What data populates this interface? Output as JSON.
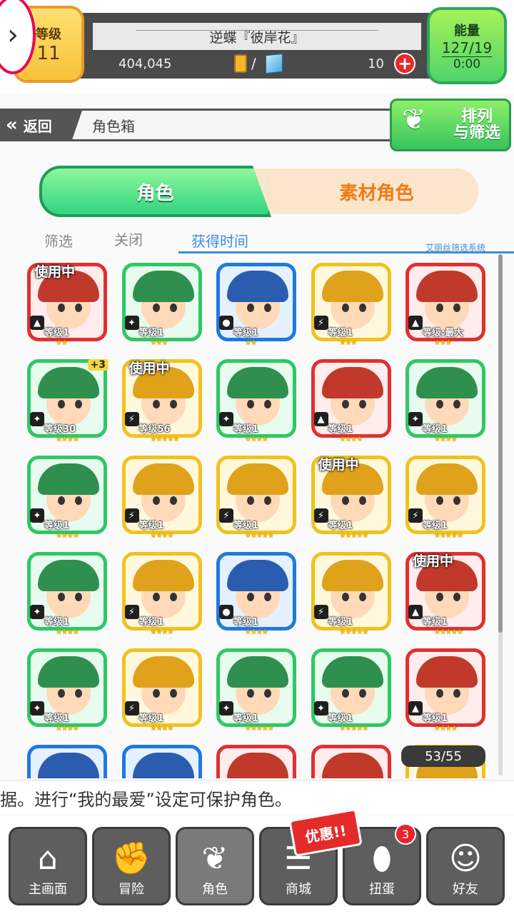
{
  "header": {
    "level_label": "等级",
    "level_value": "11",
    "player_name": "逆蝶『彼岸花』",
    "gold": "404,045",
    "stone_separator": "/",
    "stones": "10",
    "energy_label": "能量",
    "energy_value": "127/19",
    "energy_timer": "0:00",
    "plus_icon": "plus-icon",
    "colors": {
      "level_bg": "#f7c23a",
      "energy_bg": "#4fd46a"
    }
  },
  "backbar": {
    "back_label": "返回",
    "page_title": "角色箱",
    "sort_button_line1": "排列",
    "sort_button_line2": "与筛选"
  },
  "tabs": {
    "character": "角色",
    "material": "素材角色"
  },
  "filter": {
    "label": "筛选",
    "value": "关闭",
    "sort_key": "获得时间",
    "system_label": "艾丽丝筛选系统"
  },
  "cards": [
    {
      "frame": "red",
      "element": "fire",
      "level": "等级1",
      "stars": 2,
      "in_use": "使用中"
    },
    {
      "frame": "green",
      "element": "wood",
      "level": "等级1",
      "stars": 3
    },
    {
      "frame": "blue",
      "element": "water",
      "level": "等级1",
      "stars": 2
    },
    {
      "frame": "yellow",
      "element": "light",
      "level": "等级1",
      "stars": 3
    },
    {
      "frame": "red",
      "element": "fire",
      "level": "等级:最大",
      "stars": 3
    },
    {
      "frame": "green",
      "element": "wood",
      "level": "等级30",
      "stars": 4,
      "plus": "+3"
    },
    {
      "frame": "yellow",
      "element": "light",
      "level": "等级56",
      "stars": 5,
      "in_use": "使用中"
    },
    {
      "frame": "green",
      "element": "wood",
      "level": "等级1",
      "stars": 4
    },
    {
      "frame": "red",
      "element": "fire",
      "level": "等级1",
      "stars": 4
    },
    {
      "frame": "green",
      "element": "wood",
      "level": "等级1",
      "stars": 4
    },
    {
      "frame": "green",
      "element": "wood",
      "level": "等级1",
      "stars": 4
    },
    {
      "frame": "yellow",
      "element": "light",
      "level": "等级1",
      "stars": 4
    },
    {
      "frame": "yellow",
      "element": "light",
      "level": "等级1",
      "stars": 5
    },
    {
      "frame": "yellow",
      "element": "light",
      "level": "等级1",
      "stars": 5,
      "in_use": "使用中"
    },
    {
      "frame": "yellow",
      "element": "light",
      "level": "等级1",
      "stars": 5
    },
    {
      "frame": "green",
      "element": "wood",
      "level": "等级1",
      "stars": 4
    },
    {
      "frame": "yellow",
      "element": "light",
      "level": "等级1",
      "stars": 4
    },
    {
      "frame": "blue",
      "element": "water",
      "level": "等级1",
      "stars": 4
    },
    {
      "frame": "yellow",
      "element": "light",
      "level": "等级1",
      "stars": 5
    },
    {
      "frame": "red",
      "element": "fire",
      "level": "等级1",
      "stars": 5,
      "in_use": "使用中"
    },
    {
      "frame": "green",
      "element": "wood",
      "level": "等级1",
      "stars": 4
    },
    {
      "frame": "yellow",
      "element": "light",
      "level": "等级1",
      "stars": 4
    },
    {
      "frame": "green",
      "element": "wood",
      "level": "等级1",
      "stars": 5
    },
    {
      "frame": "green",
      "element": "wood",
      "level": "等级1",
      "stars": 5
    },
    {
      "frame": "red",
      "element": "fire",
      "level": "等级1",
      "stars": 4
    },
    {
      "frame": "blue",
      "element": "water"
    },
    {
      "frame": "blue",
      "element": "water"
    },
    {
      "frame": "red",
      "element": "fire"
    },
    {
      "frame": "red",
      "element": "fire"
    },
    {
      "frame": "yellow",
      "element": "light"
    }
  ],
  "count": "53/55",
  "ticker": "据。进行“我的最爱”设定可保护角色。",
  "nav": {
    "home": "主画面",
    "adventure": "冒险",
    "characters": "角色",
    "shop": "商城",
    "gacha": "扭蛋",
    "friends": "好友",
    "gacha_badge": "3",
    "sale_tag": "优惠!!"
  }
}
